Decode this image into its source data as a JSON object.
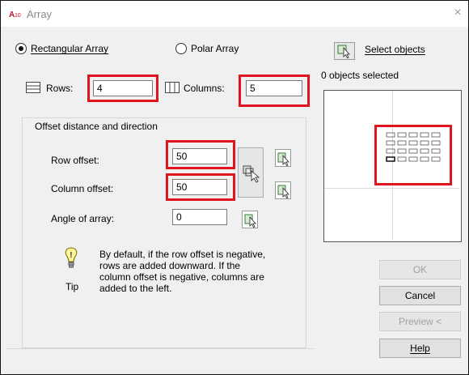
{
  "window": {
    "title": "Array",
    "close_symbol": "×"
  },
  "array_type": {
    "rectangular_label": "Rectangular Array",
    "polar_label": "Polar Array",
    "selected": "rectangular"
  },
  "rows": {
    "label": "Rows:",
    "value": "4"
  },
  "columns": {
    "label": "Columns:",
    "value": "5"
  },
  "offset": {
    "group_title": "Offset distance and direction",
    "row_offset_label": "Row offset:",
    "row_offset_value": "50",
    "column_offset_label": "Column offset:",
    "column_offset_value": "50",
    "angle_label": "Angle of array:",
    "angle_value": "0"
  },
  "tip": {
    "label": "Tip",
    "lines": [
      "By default, if the row offset is negative,",
      "rows are added downward.  If the",
      "column offset is negative, columns are",
      "added to the left."
    ]
  },
  "selection": {
    "select_objects_label": "Select objects",
    "status": "0 objects selected"
  },
  "buttons": {
    "ok": "OK",
    "cancel": "Cancel",
    "preview": "Preview <",
    "help": "Help"
  },
  "preview_grid": {
    "rows": 4,
    "columns": 5
  },
  "colors": {
    "highlight": "#e0141e"
  }
}
